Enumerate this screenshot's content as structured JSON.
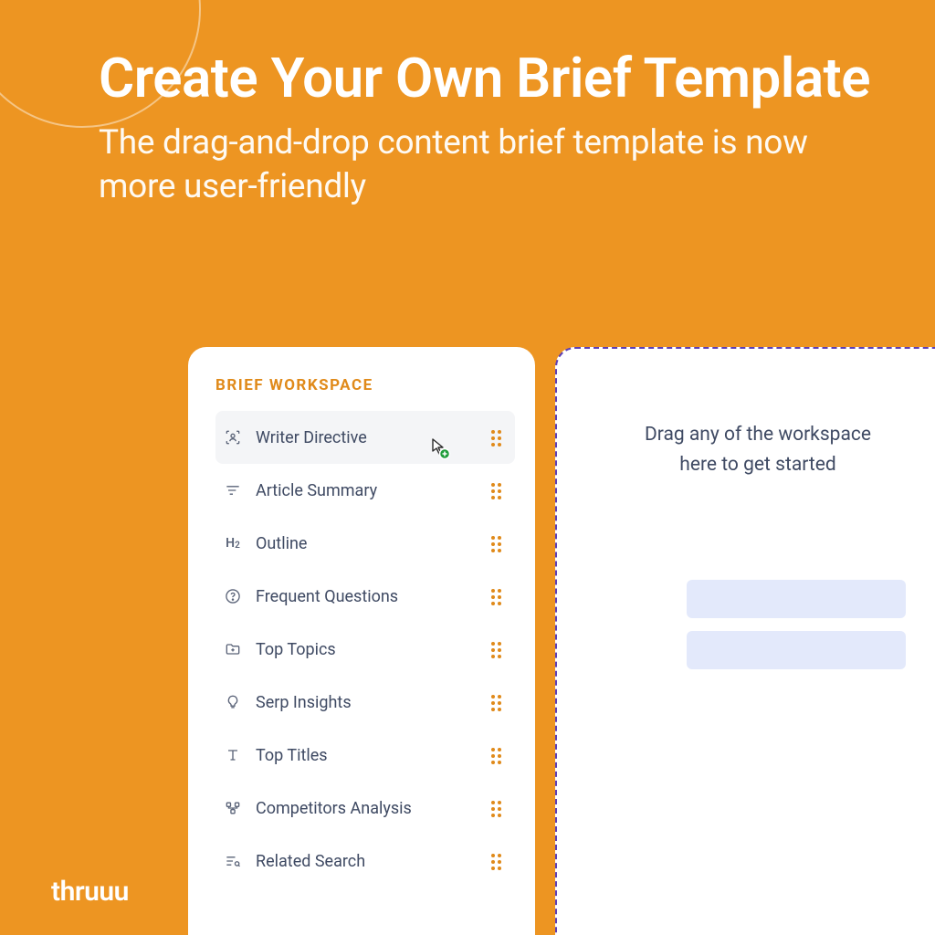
{
  "headline": {
    "title": "Create Your Own Brief Template",
    "subtitle": "The drag-and-drop content brief template is now more user-friendly"
  },
  "brand": "thruuu",
  "workspace": {
    "title": "BRIEF WORKSPACE",
    "items": [
      {
        "label": "Writer Directive"
      },
      {
        "label": "Article Summary"
      },
      {
        "label": "Outline"
      },
      {
        "label": "Frequent Questions"
      },
      {
        "label": "Top Topics"
      },
      {
        "label": "Serp Insights"
      },
      {
        "label": "Top Titles"
      },
      {
        "label": "Competitors Analysis"
      },
      {
        "label": "Related Search"
      }
    ]
  },
  "dropzone": {
    "line1": "Drag any of the workspace",
    "line2": "here to get started"
  }
}
